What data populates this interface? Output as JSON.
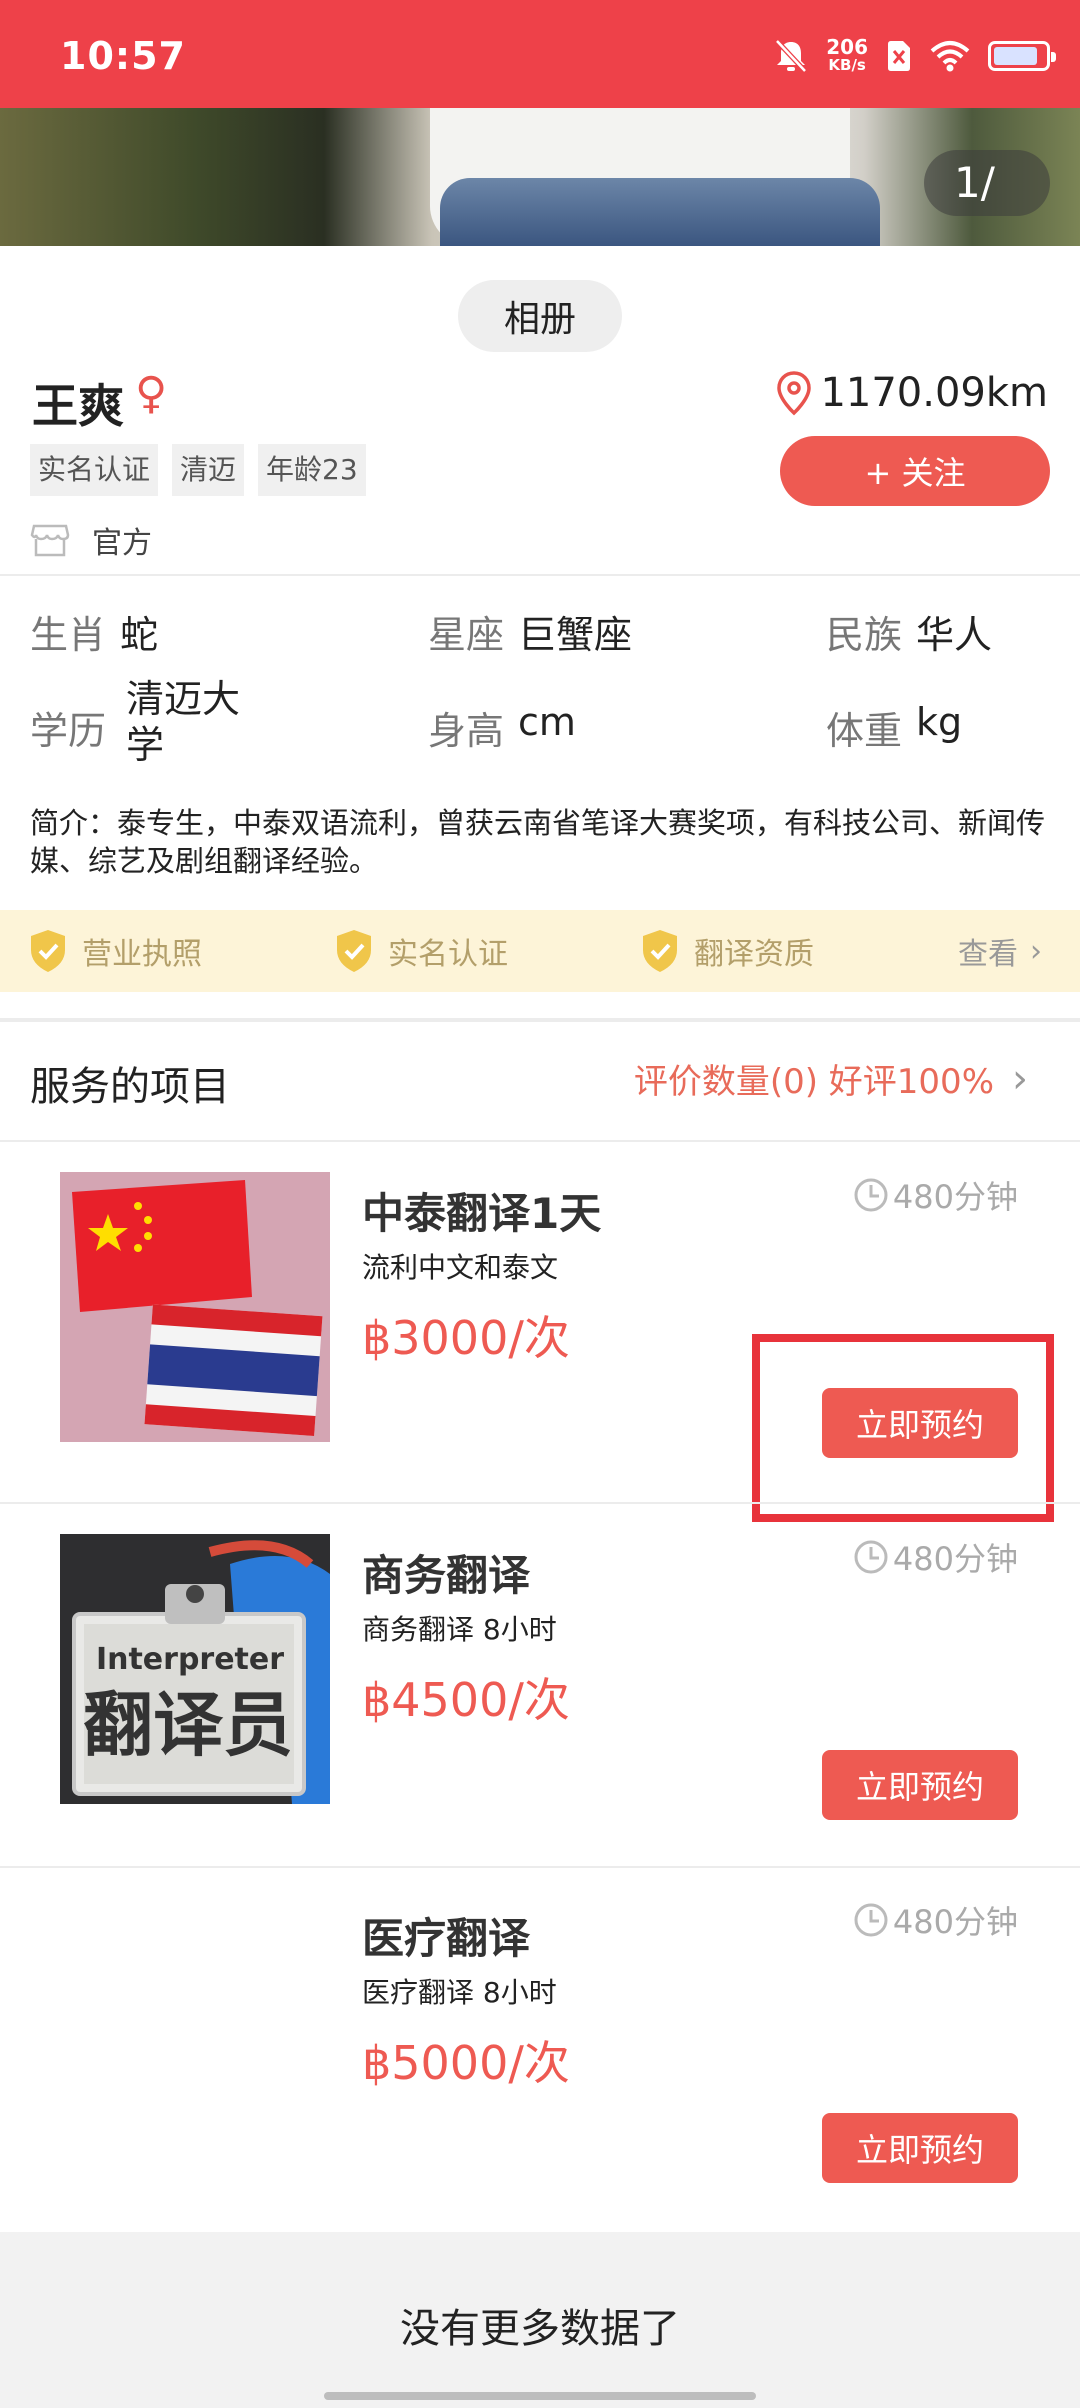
{
  "status_bar": {
    "time": "10:57",
    "net_speed_value": "206",
    "net_speed_unit": "KB/s",
    "icons": [
      "mute-bell-icon",
      "network-speed",
      "sim-off-icon",
      "wifi-icon",
      "battery-icon"
    ],
    "battery_level": 0.85
  },
  "gallery": {
    "counter": "1/"
  },
  "profile": {
    "album_label": "相册",
    "name": "王爽",
    "gender_symbol": "♀",
    "distance": "1170.09km",
    "tags": [
      "实名认证",
      "清迈",
      "年龄23"
    ],
    "follow_label": "+ 关注",
    "official_label": "官方"
  },
  "info": {
    "zodiac_label": "生肖",
    "zodiac_value": "蛇",
    "constellation_label": "星座",
    "constellation_value": "巨蟹座",
    "ethnicity_label": "民族",
    "ethnicity_value": "华人",
    "education_label": "学历",
    "education_value_line1": "清迈大",
    "education_value_line2": "学",
    "height_label": "身高",
    "height_value": "cm",
    "weight_label": "体重",
    "weight_value": "kg",
    "intro_prefix": "简介：",
    "intro_text": "泰专生，中泰双语流利，曾获云南省笔译大赛奖项，有科技公司、新闻传媒、综艺及剧组翻译经验。"
  },
  "certifications": {
    "items": [
      "营业执照",
      "实名认证",
      "翻译资质"
    ],
    "view_label": "查看"
  },
  "services": {
    "section_title": "服务的项目",
    "rating_text": "评价数量(0) 好评100%",
    "book_label": "立即预约",
    "items": [
      {
        "title": "中泰翻译1天",
        "subtitle": "流利中文和泰文",
        "price": "฿3000/次",
        "duration": "480分钟",
        "image": "china-thailand-flags-image"
      },
      {
        "title": "商务翻译",
        "subtitle": "商务翻译 8小时",
        "price": "฿4500/次",
        "duration": "480分钟",
        "image": "interpreter-badge-image",
        "badge_en": "Interpreter",
        "badge_zh": "翻译员"
      },
      {
        "title": "医疗翻译",
        "subtitle": "医疗翻译 8小时",
        "price": "฿5000/次",
        "duration": "480分钟",
        "image": ""
      }
    ]
  },
  "footer": {
    "message": "没有更多数据了"
  },
  "colors": {
    "status_bar": "#ee4149",
    "accent": "#ee5a52",
    "cert_background": "#fdf4d8",
    "highlight_box": "#e8333b"
  }
}
